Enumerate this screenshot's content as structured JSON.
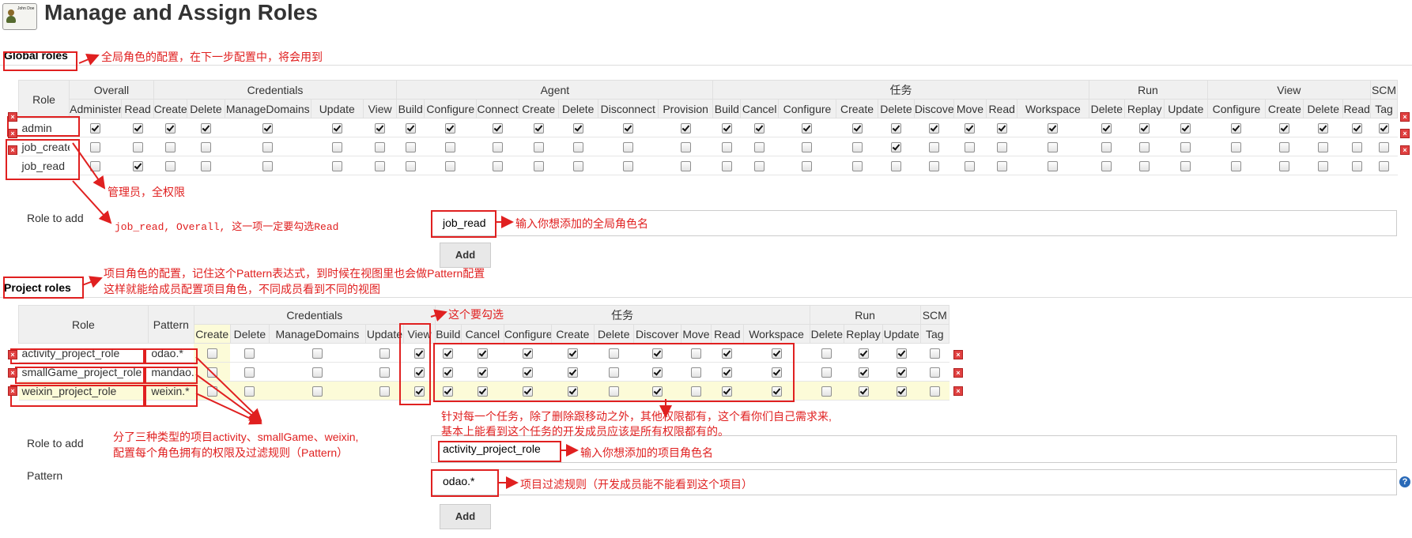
{
  "page": {
    "title": "Manage and Assign Roles",
    "logo_text": "John Doe"
  },
  "global": {
    "section_title": "Global roles",
    "role_col": "Role",
    "groups": [
      {
        "name": "Overall",
        "perms": [
          "Administer",
          "Read"
        ]
      },
      {
        "name": "Credentials",
        "perms": [
          "Create",
          "Delete",
          "ManageDomains",
          "Update",
          "View"
        ]
      },
      {
        "name": "Agent",
        "perms": [
          "Build",
          "Configure",
          "Connect",
          "Create",
          "Delete",
          "Disconnect",
          "Provision"
        ]
      },
      {
        "name": "任务",
        "perms": [
          "Build",
          "Cancel",
          "Configure",
          "Create",
          "Delete",
          "Discover",
          "Move",
          "Read",
          "Workspace"
        ]
      },
      {
        "name": "Run",
        "perms": [
          "Delete",
          "Replay",
          "Update"
        ]
      },
      {
        "name": "View",
        "perms": [
          "Configure",
          "Create",
          "Delete",
          "Read"
        ]
      },
      {
        "name": "SCM",
        "perms": [
          "Tag"
        ]
      }
    ],
    "rows": [
      {
        "role": "admin",
        "checks": [
          1,
          1,
          1,
          1,
          1,
          1,
          1,
          1,
          1,
          1,
          1,
          1,
          1,
          1,
          1,
          1,
          1,
          1,
          1,
          1,
          1,
          1,
          1,
          1,
          1,
          1,
          1,
          1,
          1,
          1,
          1
        ]
      },
      {
        "role": "job_create",
        "checks": [
          0,
          0,
          0,
          0,
          0,
          0,
          0,
          0,
          0,
          0,
          0,
          0,
          0,
          0,
          0,
          0,
          0,
          0,
          1,
          0,
          0,
          0,
          0,
          0,
          0,
          0,
          0,
          0,
          0,
          0,
          0
        ]
      },
      {
        "role": "job_read",
        "checks": [
          0,
          1,
          0,
          0,
          0,
          0,
          0,
          0,
          0,
          0,
          0,
          0,
          0,
          0,
          0,
          0,
          0,
          0,
          0,
          0,
          0,
          0,
          0,
          0,
          0,
          0,
          0,
          0,
          0,
          0,
          0
        ]
      }
    ],
    "role_to_add_label": "Role to add",
    "role_to_add_value": "job_read",
    "add_button": "Add"
  },
  "project": {
    "section_title": "Project roles",
    "role_col": "Role",
    "pattern_col": "Pattern",
    "groups": [
      {
        "name": "Credentials",
        "perms": [
          "Create",
          "Delete",
          "ManageDomains",
          "Update",
          "View"
        ]
      },
      {
        "name": "任务",
        "perms": [
          "Build",
          "Cancel",
          "Configure",
          "Create",
          "Delete",
          "Discover",
          "Move",
          "Read",
          "Workspace"
        ]
      },
      {
        "name": "Run",
        "perms": [
          "Delete",
          "Replay",
          "Update"
        ]
      },
      {
        "name": "SCM",
        "perms": [
          "Tag"
        ]
      }
    ],
    "rows": [
      {
        "role": "activity_project_role",
        "pattern": "odao.*",
        "checks": [
          0,
          0,
          0,
          0,
          1,
          1,
          1,
          1,
          1,
          0,
          1,
          0,
          1,
          1,
          0,
          1,
          1,
          0
        ]
      },
      {
        "role": "smallGame_project_role",
        "pattern": "mandao.*",
        "checks": [
          0,
          0,
          0,
          0,
          1,
          1,
          1,
          1,
          1,
          0,
          1,
          0,
          1,
          1,
          0,
          1,
          1,
          0
        ]
      },
      {
        "role": "weixin_project_role",
        "pattern": "weixin.*",
        "checks": [
          0,
          0,
          0,
          0,
          1,
          1,
          1,
          1,
          1,
          0,
          1,
          0,
          1,
          1,
          0,
          1,
          1,
          0
        ]
      }
    ],
    "role_to_add_label": "Role to add",
    "role_to_add_value": "activity_project_role",
    "pattern_label": "Pattern",
    "pattern_value": "odao.*",
    "add_button": "Add"
  },
  "annotations": {
    "global_roles": "全局角色的配置，在下一步配置中，将会用到",
    "admin": "管理员，全权限",
    "job_read": "job_read, Overall, 这一项一定要勾选Read",
    "global_input": "输入你想添加的全局角色名",
    "project_roles_1": "项目角色的配置，记住这个Pattern表达式，到时候在视图里也会做Pattern配置",
    "project_roles_2": "这样就能给成员配置项目角色，不同成员看到不同的视图",
    "view_check": "这个要勾选",
    "task_perms_1": "针对每一个任务，除了删除跟移动之外，其他权限都有，这个看你们自己需求来,",
    "task_perms_2": "基本上能看到这个任务的开发成员应该是所有权限都有的。",
    "three_types_1": "分了三种类型的项目activity、smallGame、weixin,",
    "three_types_2": "配置每个角色拥有的权限及过滤规则（Pattern）",
    "project_input": "输入你想添加的项目角色名",
    "pattern_input": "项目过滤规则（开发成员能不能看到这个项目）"
  },
  "colors": {
    "annotation": "#e02020",
    "highlight_row": "#fcfbd8",
    "header_bg": "#f0f0f0"
  }
}
